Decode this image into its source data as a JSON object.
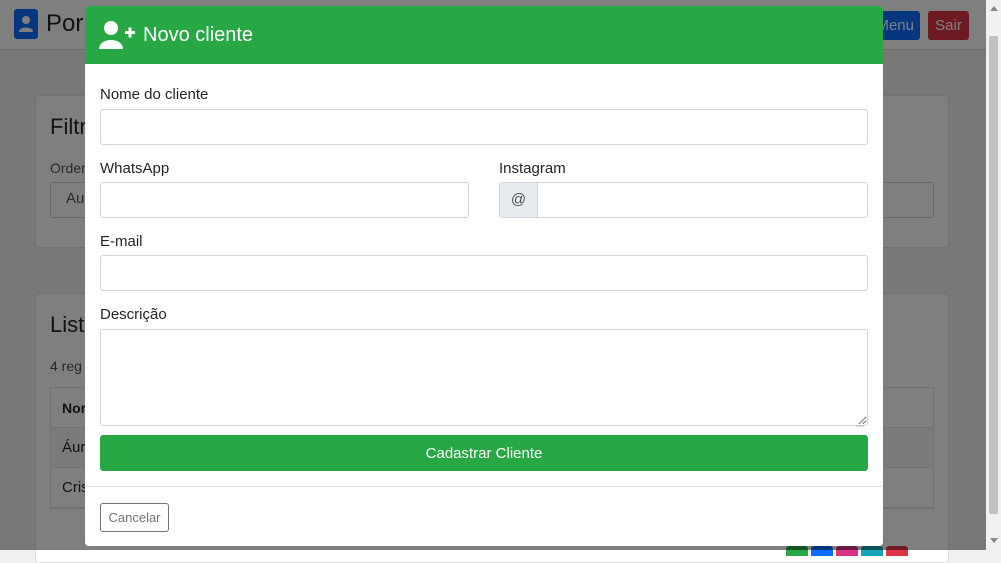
{
  "page": {
    "brand_title": "Por",
    "menu_label": "Menu",
    "exit_label": "Sair"
  },
  "filters_card": {
    "title": "Filtr",
    "order_label": "Orden",
    "order_value": "Au"
  },
  "list_card": {
    "title": "List",
    "records_text": "4 reg",
    "header_name": "Nor",
    "rows": [
      "Áur",
      "Cris"
    ]
  },
  "modal": {
    "title": "Novo cliente",
    "header_icon": "user-plus-icon",
    "fields": {
      "name_label": "Nome do cliente",
      "name_value": "",
      "whatsapp_label": "WhatsApp",
      "whatsapp_value": "",
      "instagram_label": "Instagram",
      "instagram_prefix": "@",
      "instagram_value": "",
      "email_label": "E-mail",
      "email_value": "",
      "description_label": "Descrição",
      "description_value": ""
    },
    "submit_label": "Cadastrar Cliente",
    "cancel_label": "Cancelar"
  },
  "colors": {
    "success": "#28a745",
    "primary": "#0d6efd",
    "danger": "#dc3545",
    "secondary": "#6c757d"
  }
}
